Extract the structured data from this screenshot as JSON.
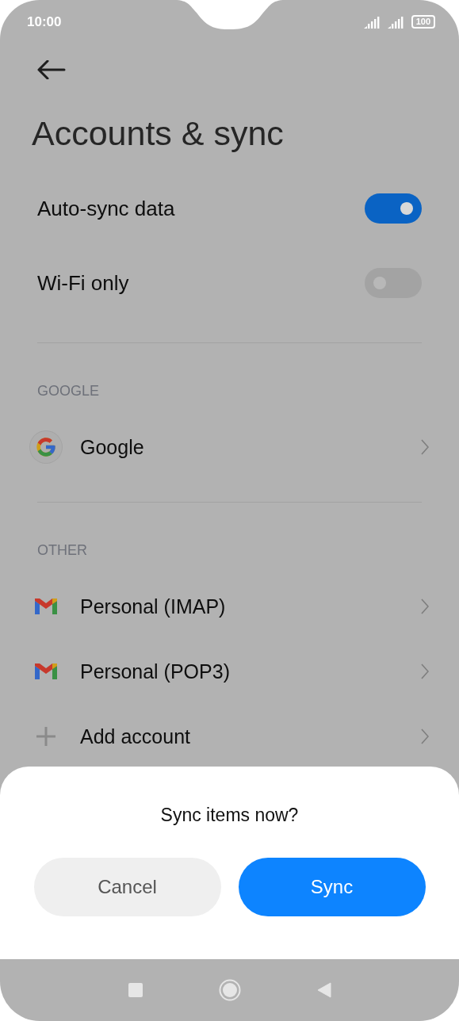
{
  "status_bar": {
    "time": "10:00",
    "battery": "100"
  },
  "title": "Accounts & sync",
  "toggles": [
    {
      "label": "Auto-sync data",
      "on": true
    },
    {
      "label": "Wi-Fi only",
      "on": false
    }
  ],
  "sections": [
    {
      "header": "GOOGLE",
      "items": [
        {
          "label": "Google",
          "kind": "google"
        }
      ]
    },
    {
      "header": "OTHER",
      "items": [
        {
          "label": "Personal (IMAP)",
          "kind": "gmail"
        },
        {
          "label": "Personal (POP3)",
          "kind": "gmail"
        },
        {
          "label": "Add account",
          "kind": "add"
        }
      ]
    }
  ],
  "dialog": {
    "title": "Sync items now?",
    "buttons": [
      {
        "label": "Cancel",
        "kind": "secondary"
      },
      {
        "label": "Sync",
        "kind": "primary"
      }
    ]
  }
}
